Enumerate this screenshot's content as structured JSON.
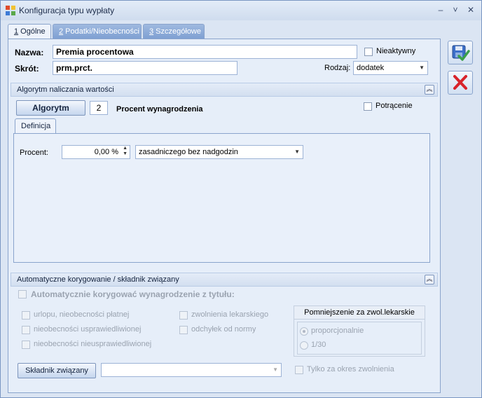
{
  "window": {
    "title": "Konfiguracja typu wypłaty"
  },
  "tabs": [
    {
      "num": "1",
      "label": " Ogólne"
    },
    {
      "num": "2",
      "label": " Podatki/Nieobecności"
    },
    {
      "num": "3",
      "label": " Szczegółowe"
    }
  ],
  "form": {
    "name_label": "Nazwa:",
    "name_value": "Premia procentowa",
    "short_label": "Skrót:",
    "short_value": "prm.prct.",
    "inactive_label": "Nieaktywny",
    "kind_label": "Rodzaj:",
    "kind_value": "dodatek"
  },
  "algorithm": {
    "section_title": "Algorytm naliczania wartości",
    "button_label": "Algorytm",
    "number": "2",
    "description": "Procent wynagrodzenia",
    "deduction_label": "Potrącenie",
    "definition_tab": "Definicja",
    "percent_label": "Procent:",
    "percent_value": "0,00 %",
    "base_value": "zasadniczego bez nadgodzin"
  },
  "autocorrect": {
    "section_title": "Automatyczne korygowanie / składnik związany",
    "main_checkbox": "Automatycznie korygować wynagrodzenie z tytułu:",
    "options_left": [
      "urlopu, nieobecności płatnej",
      "nieobecności usprawiedliwionej",
      "nieobecności nieusprawiedliwionej"
    ],
    "options_mid": [
      "zwolnienia lekarskiego",
      "odchyłek od normy"
    ],
    "reduction_title": "Pomniejszenie za zwol.lekarskie",
    "radio_options": [
      "proporcjonalnie",
      "1/30"
    ],
    "related_button": "Składnik związany",
    "related_value": "",
    "only_period_label": "Tylko za okres zwolnienia"
  },
  "colors": {
    "accent": "#7d9fd2",
    "save_check": "#3aa04a",
    "cancel_x": "#d8232a"
  }
}
